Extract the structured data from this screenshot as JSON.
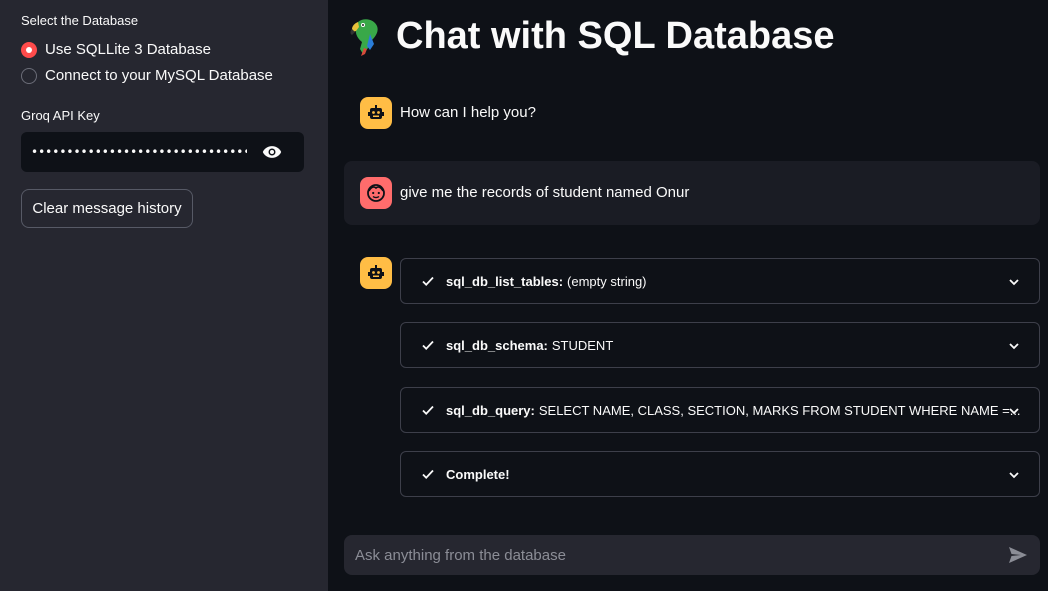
{
  "sidebar": {
    "db_label": "Select the Database",
    "options": [
      {
        "label": "Use SQLLite 3 Database",
        "selected": true
      },
      {
        "label": "Connect to your MySQL Database",
        "selected": false
      }
    ],
    "api_key_label": "Groq API Key",
    "api_key_value": "••••••••••••••••••••••••••••••••••••••••••••••••••••••",
    "clear_button": "Clear message history"
  },
  "main": {
    "title": "Chat with SQL Database",
    "messages": [
      {
        "role": "assistant",
        "text": "How can I help you?"
      },
      {
        "role": "user",
        "text": "give me the records of student named Onur"
      }
    ],
    "steps": [
      {
        "name": "sql_db_list_tables:",
        "detail": "(empty string)"
      },
      {
        "name": "sql_db_schema:",
        "detail": "STUDENT"
      },
      {
        "name": "sql_db_query:",
        "detail": "SELECT NAME, CLASS, SECTION, MARKS FROM STUDENT WHERE NAME =..."
      },
      {
        "name": "Complete!",
        "detail": ""
      }
    ],
    "chat_placeholder": "Ask anything from the database"
  },
  "colors": {
    "accent": "#ff4b4b",
    "bot_avatar": "#ffbd45",
    "user_avatar": "#ff6c6c",
    "sidebar_bg": "#262730",
    "main_bg": "#0e1117"
  },
  "icons": [
    "parrot-icon",
    "bot-icon",
    "user-face-icon",
    "eye-icon",
    "check-icon",
    "chevron-down-icon",
    "send-icon"
  ]
}
